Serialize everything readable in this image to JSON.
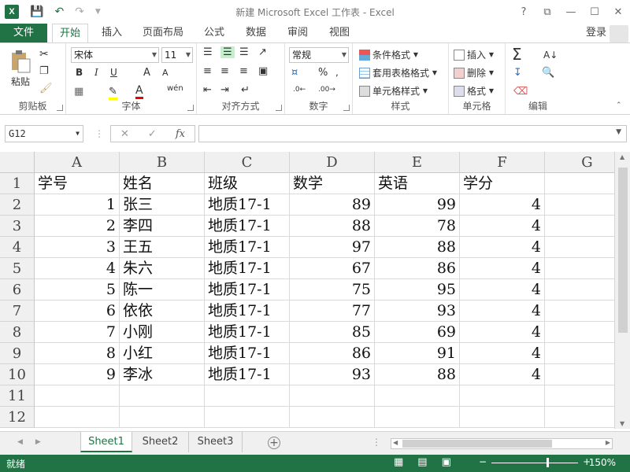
{
  "app": {
    "title": "新建 Microsoft Excel 工作表 - Excel",
    "logo": "X",
    "login": "登录",
    "window_buttons": [
      "?",
      "⧉",
      "—",
      "☐",
      "✕"
    ]
  },
  "tabs": {
    "file": "文件",
    "items": [
      "开始",
      "插入",
      "页面布局",
      "公式",
      "数据",
      "审阅",
      "视图"
    ],
    "active": "开始"
  },
  "ribbon": {
    "clipboard": {
      "label": "剪贴板",
      "paste": "粘贴"
    },
    "font": {
      "label": "字体",
      "name": "宋体",
      "size": "11",
      "bold": "B",
      "italic": "I",
      "underline": "U",
      "grow": "A",
      "shrink": "A",
      "phonetic": "wén"
    },
    "alignment": {
      "label": "对齐方式"
    },
    "number": {
      "label": "数字",
      "format": "常规",
      "percent": "%"
    },
    "styles": {
      "label": "样式",
      "conditional": "条件格式",
      "table": "套用表格格式",
      "cell_styles": "单元格样式"
    },
    "cells": {
      "label": "单元格",
      "insert": "插入",
      "delete": "删除",
      "format": "格式"
    },
    "editing": {
      "label": "编辑",
      "sum": "Σ"
    }
  },
  "formula_bar": {
    "name_box": "G12",
    "cancel": "✕",
    "enter": "✓",
    "fx": "fx",
    "value": ""
  },
  "grid": {
    "columns": [
      "A",
      "B",
      "C",
      "D",
      "E",
      "F",
      "G"
    ],
    "row_numbers": [
      "1",
      "2",
      "3",
      "4",
      "5",
      "6",
      "7",
      "8",
      "9",
      "10",
      "11",
      "12"
    ],
    "rows": [
      [
        "学号",
        "姓名",
        "班级",
        "数学",
        "英语",
        "学分",
        ""
      ],
      [
        "1",
        "张三",
        "地质17-1",
        "89",
        "99",
        "4",
        ""
      ],
      [
        "2",
        "李四",
        "地质17-1",
        "88",
        "78",
        "4",
        ""
      ],
      [
        "3",
        "王五",
        "地质17-1",
        "97",
        "88",
        "4",
        ""
      ],
      [
        "4",
        "朱六",
        "地质17-1",
        "67",
        "86",
        "4",
        ""
      ],
      [
        "5",
        "陈一",
        "地质17-1",
        "75",
        "95",
        "4",
        ""
      ],
      [
        "6",
        "依依",
        "地质17-1",
        "77",
        "93",
        "4",
        ""
      ],
      [
        "7",
        "小刚",
        "地质17-1",
        "85",
        "69",
        "4",
        ""
      ],
      [
        "8",
        "小红",
        "地质17-1",
        "86",
        "91",
        "4",
        ""
      ],
      [
        "9",
        "李冰",
        "地质17-1",
        "93",
        "88",
        "4",
        ""
      ],
      [
        "",
        "",
        "",
        "",
        "",
        "",
        ""
      ],
      [
        "",
        "",
        "",
        "",
        "",
        "",
        ""
      ]
    ]
  },
  "sheets": {
    "items": [
      "Sheet1",
      "Sheet2",
      "Sheet3"
    ],
    "active": "Sheet1",
    "add": "+"
  },
  "status": {
    "ready": "就绪",
    "zoom": "150%",
    "zoom_minus": "−",
    "zoom_plus": "+"
  },
  "colors": {
    "accent": "#217346"
  }
}
